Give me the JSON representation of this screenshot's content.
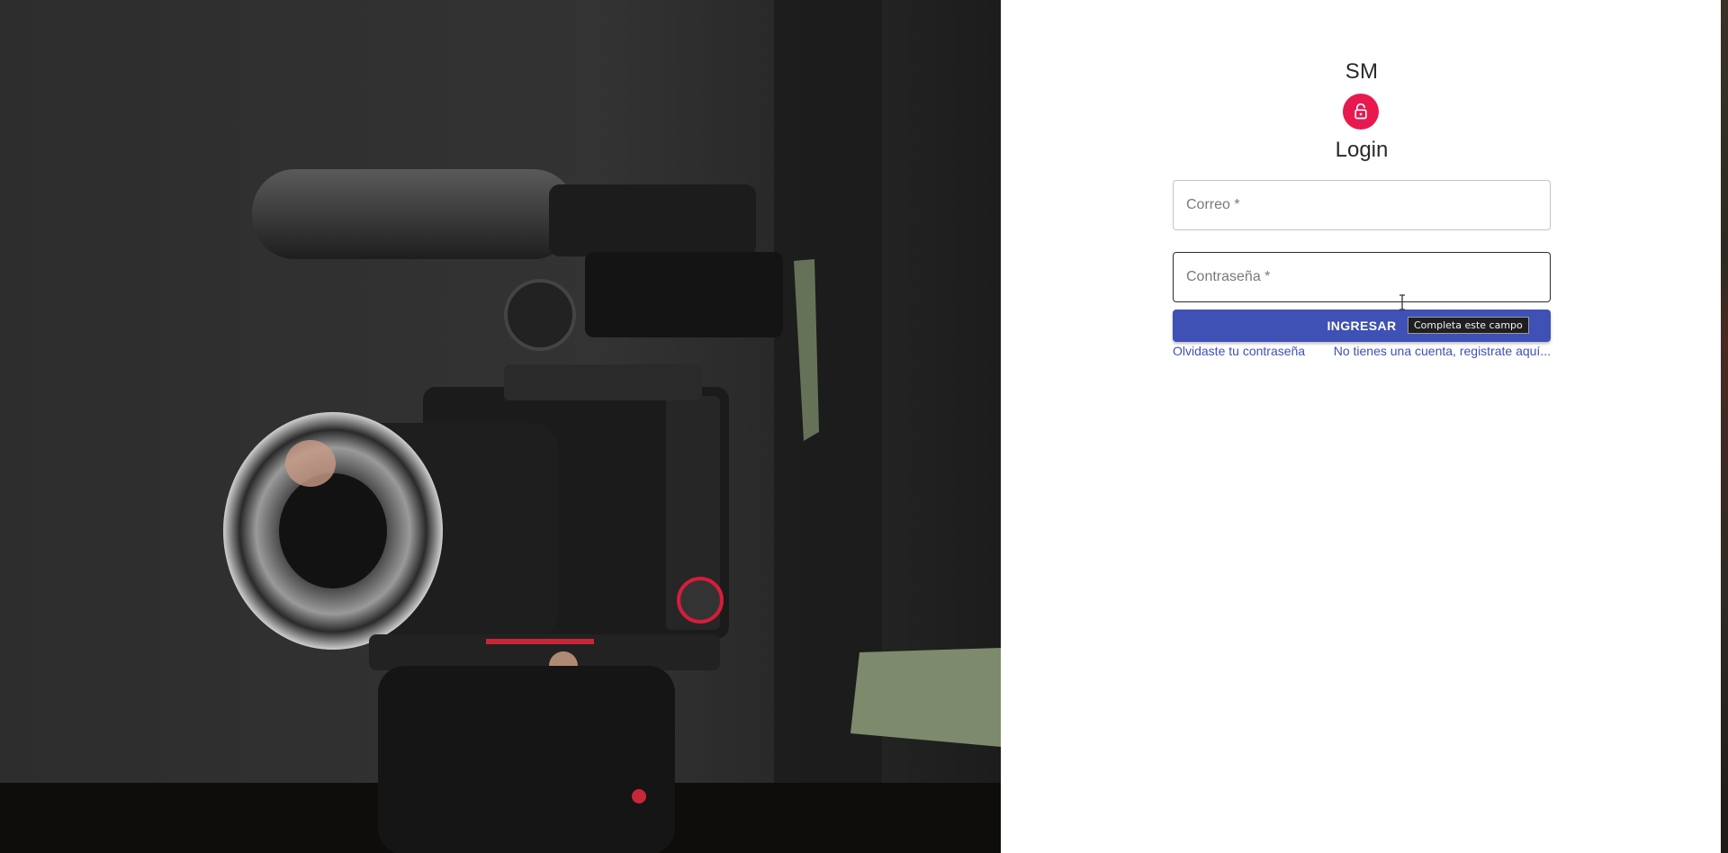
{
  "brand": {
    "name": "SM"
  },
  "login": {
    "title": "Login",
    "email_placeholder": "Correo *",
    "password_placeholder": "Contraseña *",
    "submit_label": "INGRESAR",
    "forgot_link": "Olvidaste tu contraseña",
    "register_link": "No tienes una cuenta, registrate aquí..."
  },
  "tooltip": {
    "text": "Completa este campo"
  },
  "hero": {
    "image_alt": "camera-photo"
  },
  "colors": {
    "accent": "#e8194f",
    "primary": "#3f51b5",
    "link": "#3f51b5"
  }
}
